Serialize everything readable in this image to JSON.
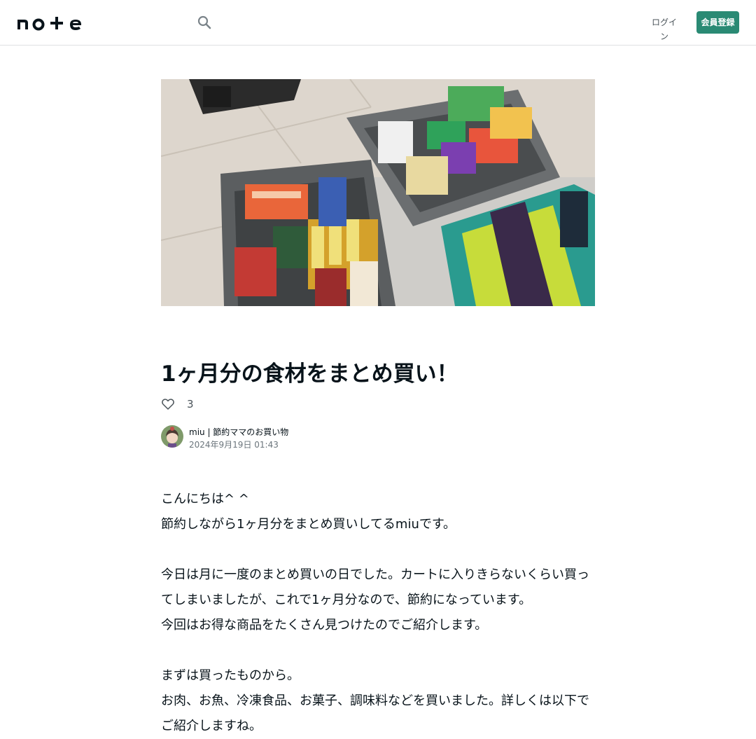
{
  "header": {
    "logo_text": "note",
    "login_label": "ログイン",
    "signup_label": "会員登録",
    "search_icon": "search-icon"
  },
  "article": {
    "eyecatch_alt": "買い物かごに入った大量の食品とトレーダージョーズのエコバッグ",
    "title": "1ヶ月分の食材をまとめ買い！",
    "like_count": "3",
    "author_name": "miu | 節約ママのお買い物",
    "post_date": "2024年9月19日 01:43",
    "paragraphs": [
      "こんにちは^ ^",
      "節約しながら1ヶ月分をまとめ買いしてるmiuです。",
      "",
      "今日は月に一度のまとめ買いの日でした。カートに入りきらないくらい買ってしまいましたが、これで1ヶ月分なので、節約になっています。",
      "今回はお得な商品をたくさん見つけたのでご紹介します。",
      "",
      "まずは買ったものから。",
      "お肉、お魚、冷凍食品、お菓子、調味料などを買いました。詳しくは以下でご紹介しますね。"
    ]
  },
  "colors": {
    "accent": "#2a8a74",
    "text": "#08131a",
    "muted": "#6b757c"
  }
}
